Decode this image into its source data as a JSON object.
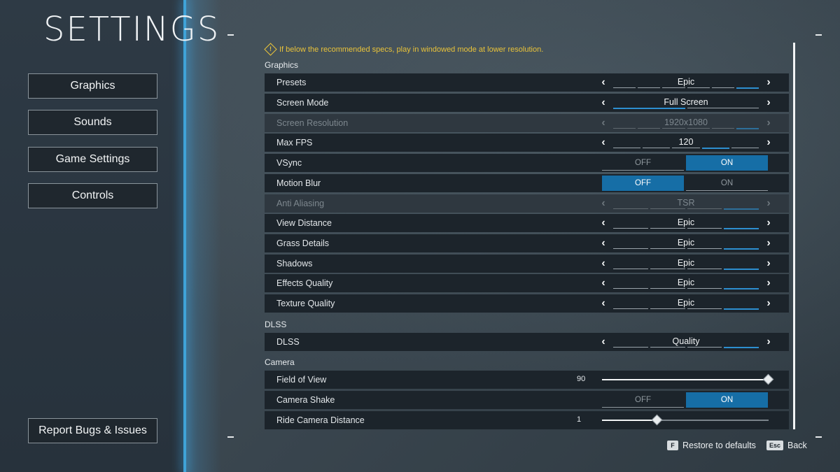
{
  "title": "SETTINGS",
  "nav": [
    "Graphics",
    "Sounds",
    "Game Settings",
    "Controls"
  ],
  "report_button": "Report Bugs & Issues",
  "warning": "If below the recommended specs, play in windowed mode at lower resolution.",
  "sections": {
    "graphics": "Graphics",
    "dlss": "DLSS",
    "camera": "Camera"
  },
  "rows": {
    "presets": {
      "label": "Presets",
      "value": "Epic"
    },
    "screen_mode": {
      "label": "Screen Mode",
      "value": "Full Screen"
    },
    "screen_resolution": {
      "label": "Screen Resolution",
      "value": "1920x1080"
    },
    "max_fps": {
      "label": "Max FPS",
      "value": "120"
    },
    "vsync": {
      "label": "VSync",
      "off": "OFF",
      "on": "ON",
      "state": "ON"
    },
    "motion_blur": {
      "label": "Motion Blur",
      "off": "OFF",
      "on": "ON",
      "state": "OFF"
    },
    "anti_aliasing": {
      "label": "Anti Aliasing",
      "value": "TSR"
    },
    "view_distance": {
      "label": "View Distance",
      "value": "Epic"
    },
    "grass_details": {
      "label": "Grass Details",
      "value": "Epic"
    },
    "shadows": {
      "label": "Shadows",
      "value": "Epic"
    },
    "effects_quality": {
      "label": "Effects Quality",
      "value": "Epic"
    },
    "texture_quality": {
      "label": "Texture Quality",
      "value": "Epic"
    },
    "dlss": {
      "label": "DLSS",
      "value": "Quality"
    },
    "field_of_view": {
      "label": "Field of View",
      "value": "90",
      "fraction": 1.0
    },
    "camera_shake": {
      "label": "Camera Shake",
      "off": "OFF",
      "on": "ON",
      "state": "ON"
    },
    "ride_camera_distance": {
      "label": "Ride Camera Distance",
      "value": "1",
      "fraction": 0.33
    }
  },
  "footer": {
    "restore_key": "F",
    "restore_label": "Restore to defaults",
    "back_key": "Esc",
    "back_label": "Back"
  },
  "colors": {
    "accent": "#166ea6",
    "segment_active": "#2d8fd0",
    "warning": "#e8c23a"
  }
}
